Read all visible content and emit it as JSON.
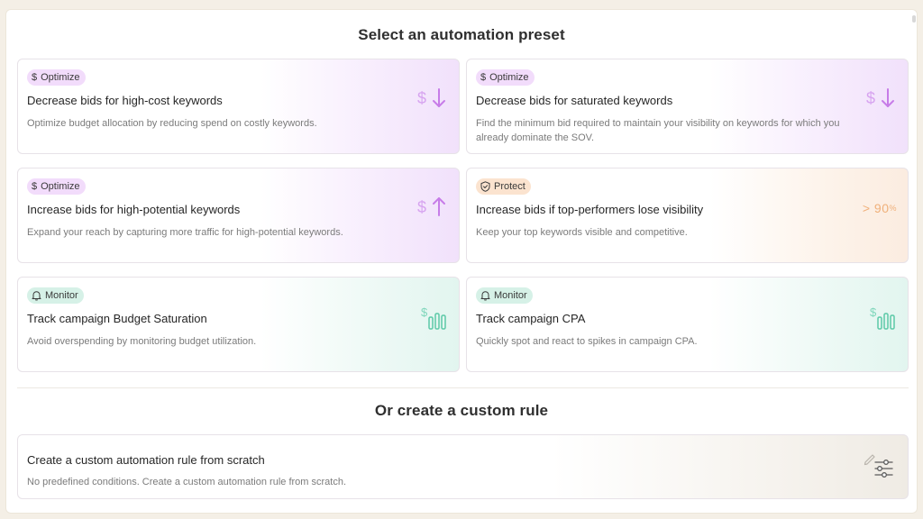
{
  "presets": {
    "title": "Select an automation preset",
    "cards": [
      {
        "badge": {
          "label": "Optimize",
          "icon": "dollar-icon",
          "glyph": "$",
          "color": "#f2dcfb"
        },
        "title": "Decrease bids for high-cost keywords",
        "description": "Optimize budget allocation by reducing spend on costly keywords.",
        "icon": "dollar-down-icon"
      },
      {
        "badge": {
          "label": "Optimize",
          "icon": "dollar-icon",
          "glyph": "$",
          "color": "#f2dcfb"
        },
        "title": "Decrease bids for saturated keywords",
        "description": "Find the minimum bid required to maintain your visibility on keywords for which you already dominate the SOV.",
        "icon": "dollar-down-icon"
      },
      {
        "badge": {
          "label": "Optimize",
          "icon": "dollar-icon",
          "glyph": "$",
          "color": "#f2dcfb"
        },
        "title": "Increase bids for high-potential keywords",
        "description": "Expand your reach by capturing more traffic for high-potential keywords.",
        "icon": "dollar-up-icon"
      },
      {
        "badge": {
          "label": "Protect",
          "icon": "shield-check-icon",
          "color": "#fbe3cf"
        },
        "title": "Increase bids if top-performers lose visibility",
        "description": "Keep your top keywords visible and competitive.",
        "icon": "percent-threshold-icon",
        "icon_text": "> 90",
        "icon_unit": "%"
      },
      {
        "badge": {
          "label": "Monitor",
          "icon": "bell-icon",
          "color": "#d6f1e7"
        },
        "title": "Track campaign Budget Saturation",
        "description": "Avoid overspending by monitoring budget utilization.",
        "icon": "dollar-bars-icon"
      },
      {
        "badge": {
          "label": "Monitor",
          "icon": "bell-icon",
          "color": "#d6f1e7"
        },
        "title": "Track campaign CPA",
        "description": "Quickly spot and react to spikes in campaign CPA.",
        "icon": "dollar-bars-icon"
      }
    ]
  },
  "custom": {
    "title": "Or create a custom rule",
    "card": {
      "title": "Create a custom automation rule from scratch",
      "description": "No predefined conditions. Create a custom automation rule from scratch.",
      "icon": "pencil-sliders-icon"
    }
  },
  "colors": {
    "optimize_accent": "#c77ce8",
    "protect_accent": "#f0b07a",
    "monitor_accent": "#5cc9a7"
  }
}
